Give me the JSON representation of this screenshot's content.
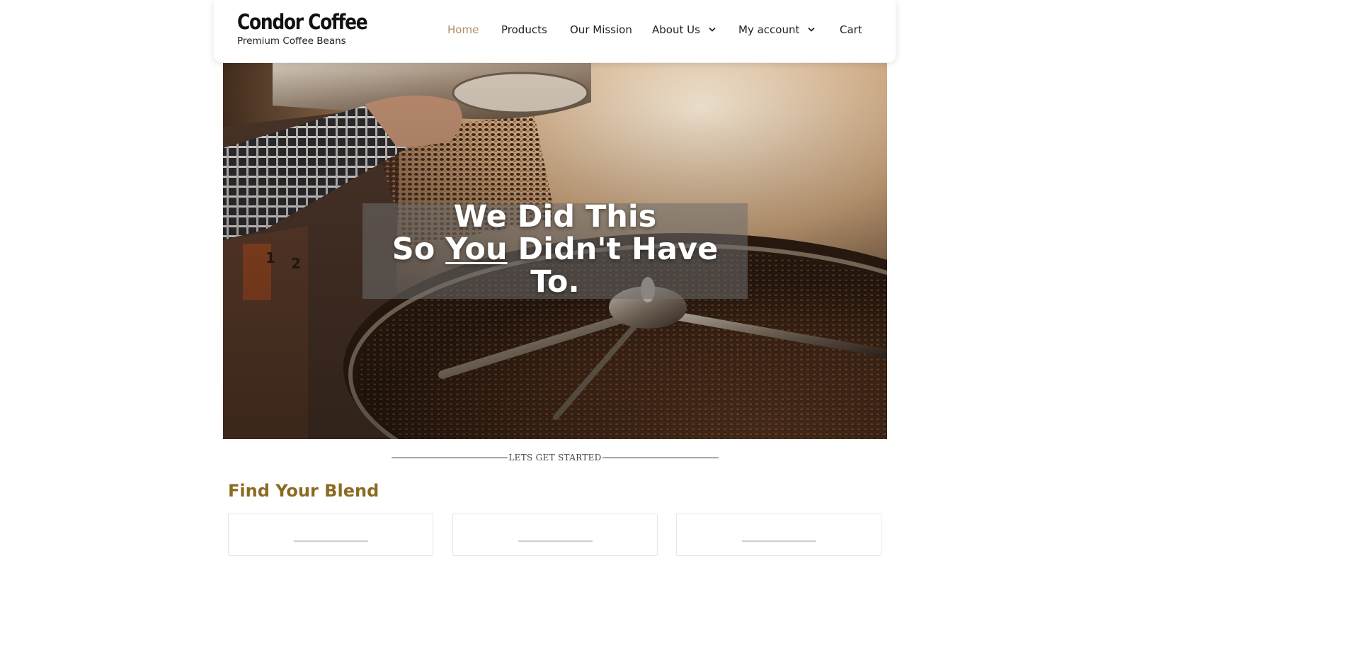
{
  "header": {
    "brand": "Condor Coffee",
    "tagline": "Premium Coffee Beans",
    "nav": [
      {
        "label": "Home",
        "active": true
      },
      {
        "label": "Products"
      },
      {
        "label": "Our Mission"
      },
      {
        "label": "About Us",
        "has_dropdown": true
      },
      {
        "label": "My account",
        "has_dropdown": true
      },
      {
        "label": "Cart"
      }
    ]
  },
  "hero": {
    "line1": "We Did This",
    "line2_prefix": "So ",
    "line2_emphasis": "You",
    "line2_suffix": " Didn't Have",
    "line3": "To."
  },
  "divider": {
    "label": "LETS GET STARTED"
  },
  "section": {
    "title": "Find Your Blend"
  },
  "colors": {
    "nav_active": "#b08a66",
    "section_title": "#8b6a22"
  }
}
